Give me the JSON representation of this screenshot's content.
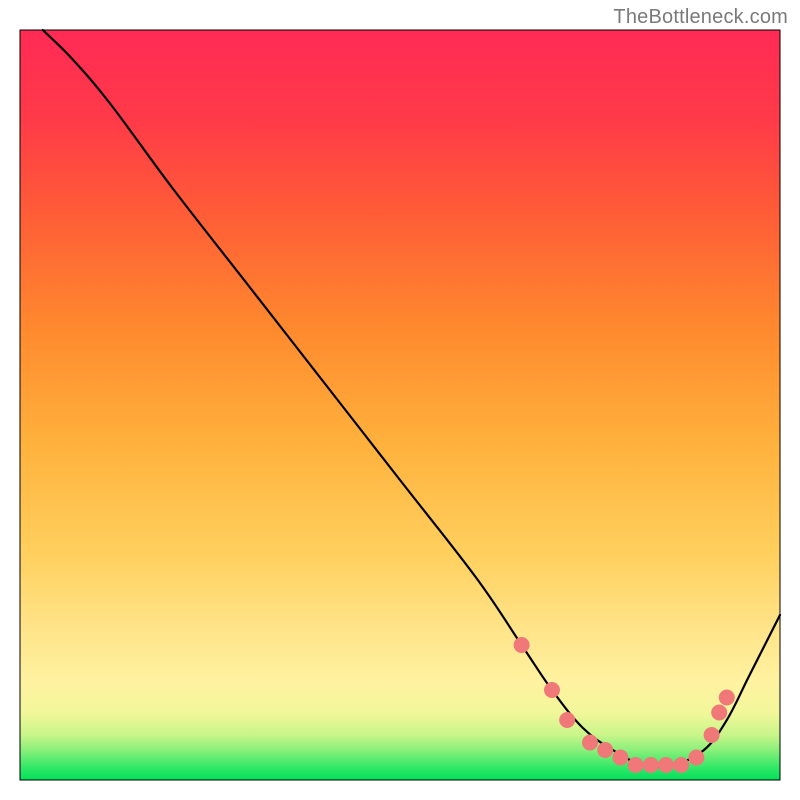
{
  "watermark": "TheBottleneck.com",
  "chart_data": {
    "type": "line",
    "title": "",
    "xlabel": "",
    "ylabel": "",
    "xlim": [
      0,
      100
    ],
    "ylim": [
      0,
      100
    ],
    "gradient_stops": [
      {
        "offset": 0.0,
        "color": "#00e05a"
      },
      {
        "offset": 0.02,
        "color": "#3de96a"
      },
      {
        "offset": 0.04,
        "color": "#8af07a"
      },
      {
        "offset": 0.06,
        "color": "#c8f58a"
      },
      {
        "offset": 0.09,
        "color": "#f2f79a"
      },
      {
        "offset": 0.13,
        "color": "#fff2a0"
      },
      {
        "offset": 0.2,
        "color": "#ffe48a"
      },
      {
        "offset": 0.3,
        "color": "#ffd05e"
      },
      {
        "offset": 0.45,
        "color": "#ffb13c"
      },
      {
        "offset": 0.6,
        "color": "#ff8a2e"
      },
      {
        "offset": 0.75,
        "color": "#ff5e36"
      },
      {
        "offset": 0.88,
        "color": "#ff3a48"
      },
      {
        "offset": 1.0,
        "color": "#ff2a55"
      }
    ],
    "series": [
      {
        "name": "bottleneck-curve",
        "x": [
          3,
          7,
          12,
          20,
          30,
          40,
          50,
          60,
          66,
          70,
          74,
          78,
          82,
          86,
          90,
          93,
          96,
          100
        ],
        "y": [
          100,
          96,
          90,
          79,
          66,
          53,
          40,
          27,
          18,
          12,
          7,
          4,
          2,
          2,
          4,
          8,
          14,
          22
        ]
      }
    ],
    "markers": {
      "name": "highlighted-points",
      "color": "#f07878",
      "radius": 8,
      "points": [
        {
          "x": 66,
          "y": 18
        },
        {
          "x": 70,
          "y": 12
        },
        {
          "x": 72,
          "y": 8
        },
        {
          "x": 75,
          "y": 5
        },
        {
          "x": 77,
          "y": 4
        },
        {
          "x": 79,
          "y": 3
        },
        {
          "x": 81,
          "y": 2
        },
        {
          "x": 83,
          "y": 2
        },
        {
          "x": 85,
          "y": 2
        },
        {
          "x": 87,
          "y": 2
        },
        {
          "x": 89,
          "y": 3
        },
        {
          "x": 91,
          "y": 6
        },
        {
          "x": 92,
          "y": 9
        },
        {
          "x": 93,
          "y": 11
        }
      ]
    }
  }
}
